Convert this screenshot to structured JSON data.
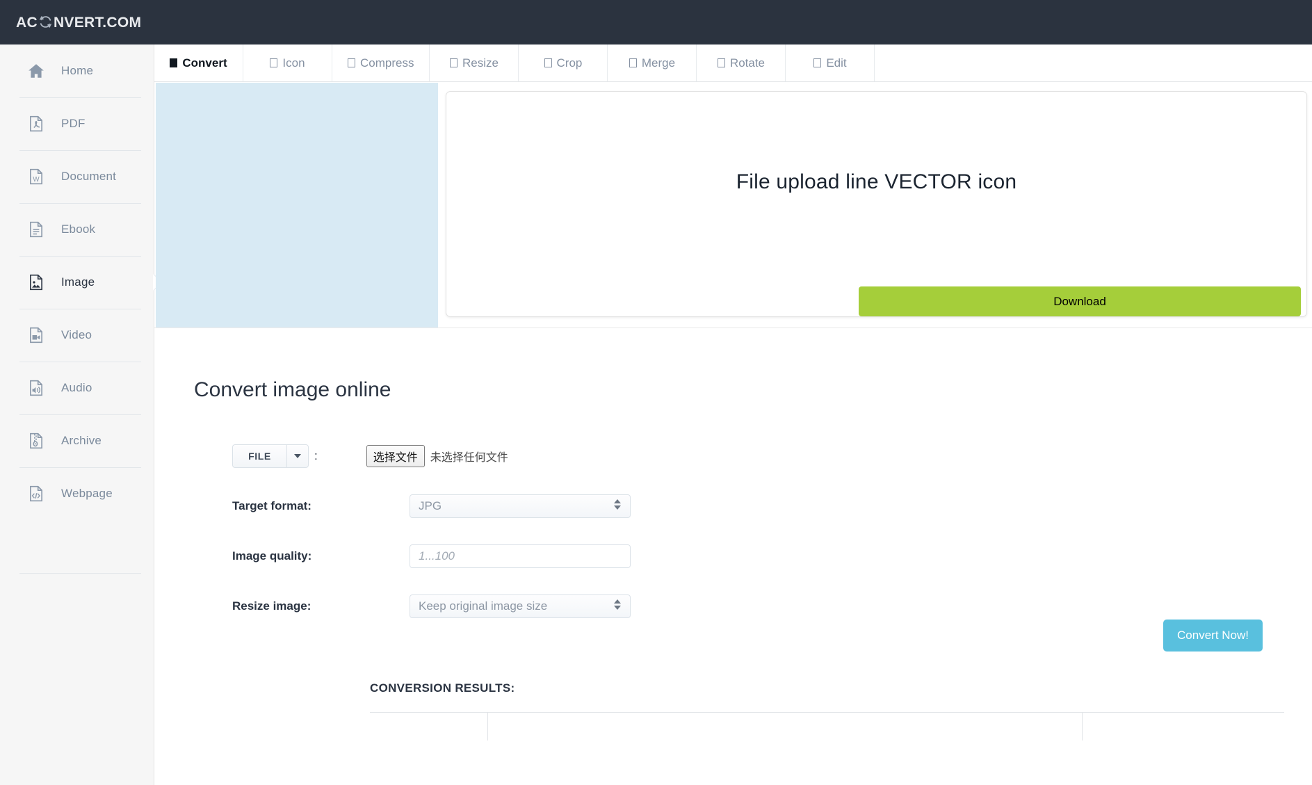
{
  "brand": {
    "text_before": "AC",
    "icon": "refresh-icon",
    "text_after": "NVERT.COM"
  },
  "tabs": [
    {
      "label": "Convert",
      "icon": "square-filled-icon",
      "active": true
    },
    {
      "label": "Icon",
      "icon": "square-icon",
      "active": false
    },
    {
      "label": "Compress",
      "icon": "square-icon",
      "active": false
    },
    {
      "label": "Resize",
      "icon": "square-icon",
      "active": false
    },
    {
      "label": "Crop",
      "icon": "square-icon",
      "active": false
    },
    {
      "label": "Merge",
      "icon": "square-icon",
      "active": false
    },
    {
      "label": "Rotate",
      "icon": "square-icon",
      "active": false
    },
    {
      "label": "Edit",
      "icon": "square-icon",
      "active": false
    }
  ],
  "sidebar": {
    "items": [
      {
        "label": "Home",
        "icon": "home-icon",
        "active": false
      },
      {
        "label": "PDF",
        "icon": "pdf-file-icon",
        "active": false
      },
      {
        "label": "Document",
        "icon": "word-file-icon",
        "active": false
      },
      {
        "label": "Ebook",
        "icon": "ebook-file-icon",
        "active": false
      },
      {
        "label": "Image",
        "icon": "image-file-icon",
        "active": true
      },
      {
        "label": "Video",
        "icon": "video-file-icon",
        "active": false
      },
      {
        "label": "Audio",
        "icon": "audio-file-icon",
        "active": false
      },
      {
        "label": "Archive",
        "icon": "archive-file-icon",
        "active": false
      },
      {
        "label": "Webpage",
        "icon": "webpage-file-icon",
        "active": false
      }
    ]
  },
  "preview": {
    "image_caption": "File upload line VECTOR icon",
    "download_label": "Download"
  },
  "main": {
    "title": "Convert image online",
    "file_row": {
      "source_type": "FILE",
      "caret_icon": "chevron-down-icon",
      "separator": ":",
      "choose_file_label": "选择文件",
      "no_file_text": "未选择任何文件"
    },
    "target_format": {
      "label": "Target format:",
      "value": "JPG",
      "stepper_icon": "stepper-updown-icon"
    },
    "image_quality": {
      "label": "Image quality:",
      "value": "",
      "placeholder": "1...100"
    },
    "resize_image": {
      "label": "Resize image:",
      "value": "Keep original image size",
      "stepper_icon": "stepper-updown-icon"
    },
    "convert_button": "Convert Now!",
    "results_title": "CONVERSION RESULTS:"
  },
  "colors": {
    "topbar": "#2b333f",
    "sidebar": "#f6f6f6",
    "ad_placeholder": "#d8eaf4",
    "download_green": "#a5ce3a",
    "convert_blue": "#59c0de",
    "text_dark": "#2b3442",
    "text_muted": "#7b8a9c"
  }
}
